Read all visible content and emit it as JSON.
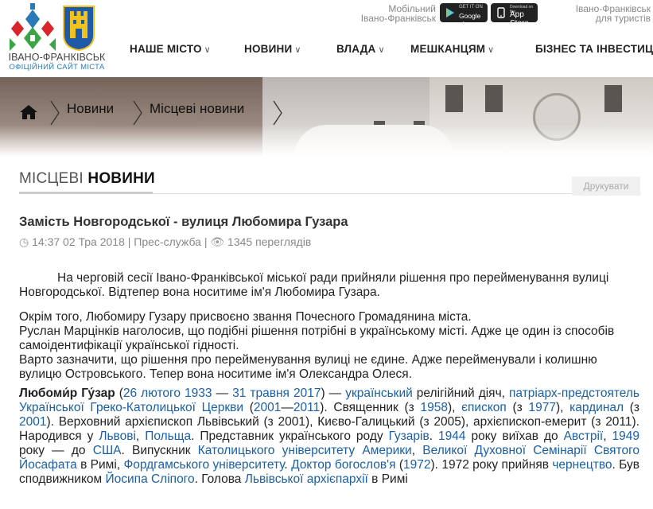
{
  "header": {
    "logo_title": "ІВАНО-ФРАНКІВСЬК",
    "logo_subtitle": "ОФІЦІЙНИЙ САЙТ МІСТА",
    "mobile_line1": "Мобільний",
    "mobile_line2": "Івано-Франківськ",
    "google_play_top": "GET IT ON",
    "google_play": "Google play",
    "app_store_top": "Download on the",
    "app_store": "App Store",
    "tourist_line1": "Івано-Франківськ",
    "tourist_line2": "для туристів"
  },
  "nav": [
    {
      "label": "НАШЕ МІСТО"
    },
    {
      "label": "НОВИНИ"
    },
    {
      "label": "ВЛАДА"
    },
    {
      "label": "МЕШКАНЦЯМ"
    },
    {
      "label": "БІЗНЕС ТА ІНВЕСТИЦ"
    }
  ],
  "breadcrumb": {
    "item1": "Новини",
    "item2": "Місцеві новини"
  },
  "section": {
    "title_light": "МІСЦЕВІ",
    "title_bold": "НОВИНИ",
    "print_label": "Друкувати"
  },
  "article": {
    "title": "Замість Новгородської - вулиця Любомира Гузара",
    "time": "14:37 02 Тра 2018",
    "author": "Прес-служба",
    "views": "1345 переглядів",
    "p1": "На черговій сесії Івано-Франківської міської ради прийняли рішення про перейменування вулиці Новгородської. Відтепер вона носитиме ім'я Любомира Гузара.",
    "p2a": "Окрім того, Любомиру Гузару присвоєно звання Почесного Громадянина міста.",
    "p2b": "Руслан Марцінків наголосив, що подібні рішення потрібні в українському місті. Адже це один із способів самоідентифікації української гідності.",
    "p2c": "Варто зазначити, що рішення про перейменування вулиці не єдине. Адже перейменували і колишню вулицю Островського. Тепер вона носитиме ім'я Олександра Олеся.",
    "bio": {
      "name": "Любоми́р Гу́зар",
      "t1": " (",
      "l1": "26 лютого",
      "t2": " ",
      "l2": "1933",
      "t3": " — ",
      "l3": "31 травня",
      "t4": " ",
      "l4": "2017",
      "t5": ") — ",
      "l5": "український",
      "t6": " релігійний діяч, ",
      "l6": "патріарх-предстоятель Української Греко-Католицької Церкви",
      "t7": " (",
      "l7": "2001",
      "t8": "—",
      "l8": "2011",
      "t9": "). Священник (з ",
      "l9": "1958",
      "t10": "), ",
      "l10": "єпископ",
      "t11": " (з ",
      "l11": "1977",
      "t12": "), ",
      "l12": "кардинал",
      "t13": " (з ",
      "l13": "2001",
      "t14": "). Верховний архієпископ Львівський (з 2001), Києво-Галицький (з 2005), архієпископ-емерит (з 2011). Народився у ",
      "l14": "Львові",
      "t15": ", ",
      "l15": "Польща",
      "t16": ". Представник українського роду ",
      "l16": "Гузарів",
      "t17": ". ",
      "l17": "1944",
      "t18": " року виїхав до ",
      "l18": "Австрії",
      "t19": ", ",
      "l19": "1949",
      "t20": " року — до ",
      "l20": "США",
      "t21": ". Випускник ",
      "l21": "Католицького університету Америки",
      "t22": ", ",
      "l22": "Великої Духовної Семінарії Святого Йосафата",
      "t23": " в Римі, ",
      "l23": "Фордгамського університету",
      "t24": ". ",
      "l24": "Доктор богослов'я",
      "t25": " (",
      "l25": "1972",
      "t26": "). 1972 року прийняв ",
      "l26": "чернецтво",
      "t27": ". Був сподвижником ",
      "l27": "Йосипа Сліпого",
      "t28": ". Голова ",
      "l28": "Львівської архієпархії",
      "t29": " в Римі"
    }
  },
  "colors": {
    "link": "#1a5fa8",
    "logo_blue": "#2a7ab8",
    "logo_red": "#d9262c",
    "logo_green": "#3aa447",
    "coat_blue": "#1f5aa8",
    "coat_yellow": "#f1c21b"
  }
}
